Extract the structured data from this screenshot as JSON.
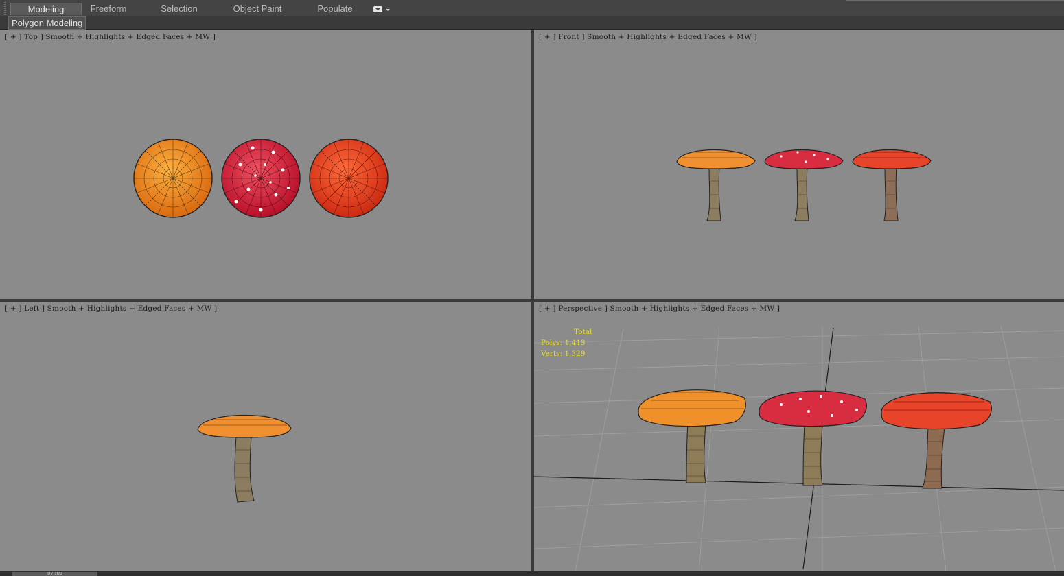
{
  "ribbon": {
    "tabs": [
      {
        "label": "Modeling",
        "active": true
      },
      {
        "label": "Freeform",
        "active": false
      },
      {
        "label": "Selection",
        "active": false
      },
      {
        "label": "Object Paint",
        "active": false
      },
      {
        "label": "Populate",
        "active": false
      }
    ],
    "panel_label": "Polygon Modeling"
  },
  "viewports": {
    "top": {
      "label": "[ + ] Top ] Smooth + Highlights + Edged Faces + MW ]"
    },
    "front": {
      "label": "[ + ] Front ] Smooth + Highlights + Edged Faces + MW ]"
    },
    "left": {
      "label": "[ + ] Left ] Smooth + Highlights + Edged Faces + MW ]"
    },
    "perspective": {
      "label": "[ + ] Perspective ] Smooth + Highlights + Edged Faces + MW ]"
    }
  },
  "stats": {
    "total_label": "Total",
    "polys": "Polys: 1,419",
    "verts": "Verts: 1,329"
  },
  "timeline": {
    "frame": "0 / 100"
  },
  "colors": {
    "viewport_bg": "#8b8b8b",
    "cap_orange": "#f08a20",
    "cap_red_spotted": "#d42a3a",
    "cap_red": "#e8401e",
    "stem": "#8a7a62",
    "stats_text": "#e8e010"
  }
}
